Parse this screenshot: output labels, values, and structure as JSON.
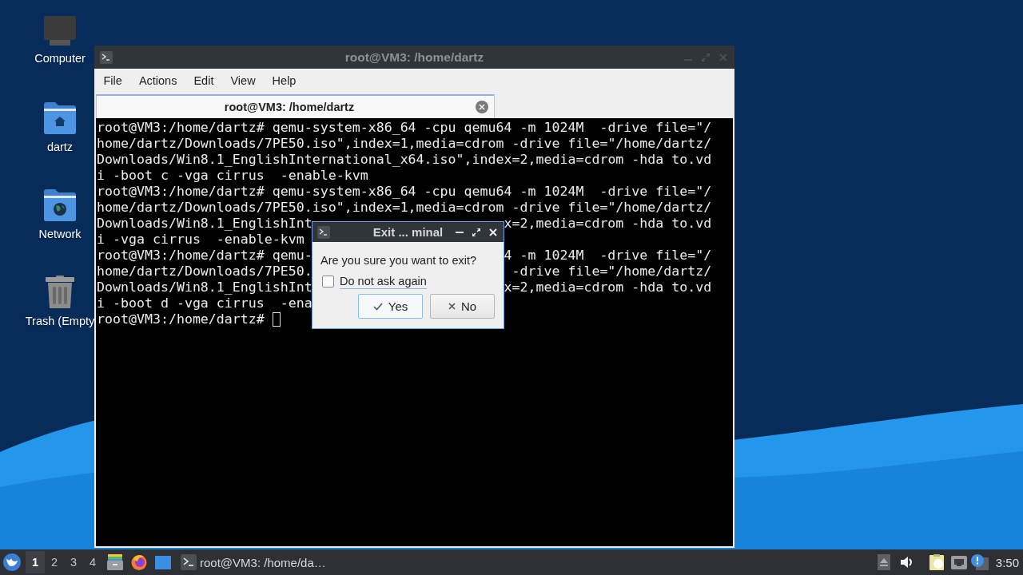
{
  "desktop_icons": [
    {
      "label": "Computer",
      "kind": "computer"
    },
    {
      "label": "dartz",
      "kind": "home"
    },
    {
      "label": "Network",
      "kind": "network"
    },
    {
      "label": "Trash (Empty",
      "kind": "trash"
    }
  ],
  "terminal_window": {
    "title": "root@VM3: /home/dartz",
    "menu": [
      "File",
      "Actions",
      "Edit",
      "View",
      "Help"
    ],
    "tab": "root@VM3: /home/dartz",
    "cursor": true,
    "lines": [
      {
        "text": "root@VM3:/home/dartz# qemu-system-x86_64 -cpu qemu64 -m 1024M  -drive file=\"/"
      },
      {
        "text": "home/dartz/Downloads/7PE50.iso\",index=1,media=cdrom -drive file=\"/home/dartz/"
      },
      {
        "text": "Downloads/Win8.1_EnglishInternational_x64.iso\",index=2,media=cdrom -hda to.vd"
      },
      {
        "text": "i -boot c -vga cirrus  -enable-kvm"
      },
      {
        "text": "root@VM3:/home/dartz# qemu-system-x86_64 -cpu qemu64 -m 1024M  -drive file=\"/"
      },
      {
        "text": "home/dartz/Downloads/7PE50.iso\",index=1,media=cdrom -drive file=\"/home/dartz/"
      },
      {
        "text": "Downloads/Win8.1_EnglishInt",
        "right": "x=2,media=cdrom -hda to.vd"
      },
      {
        "text": "i -vga cirrus  -enable-kvm"
      },
      {
        "text": "root@VM3:/home/dartz# qemu-",
        "right": "4 -m 1024M  -drive file=\"/"
      },
      {
        "text": "home/dartz/Downloads/7PE50.",
        "right": "-drive file=\"/home/dartz/"
      },
      {
        "text": "Downloads/Win8.1_EnglishInt",
        "right": "x=2,media=cdrom -hda to.vd"
      },
      {
        "text": "i -boot d -vga cirrus  -ena"
      },
      {
        "text": "root@VM3:/home/dartz#"
      }
    ]
  },
  "dialog": {
    "title": "Exit ... minal",
    "message": "Are you sure you want to exit?",
    "checkbox": {
      "label": "Do not ask again",
      "checked": false
    },
    "buttons": [
      {
        "label": "Yes",
        "kind": "confirm",
        "default": true
      },
      {
        "label": "No",
        "kind": "cancel",
        "default": false
      }
    ]
  },
  "taskbar": {
    "workspaces": [
      {
        "label": "1",
        "selected": true
      },
      {
        "label": "2",
        "selected": false
      },
      {
        "label": "3",
        "selected": false
      },
      {
        "label": "4",
        "selected": false
      }
    ],
    "window_button": "root@VM3: /home/da…",
    "clock": "3:50"
  }
}
